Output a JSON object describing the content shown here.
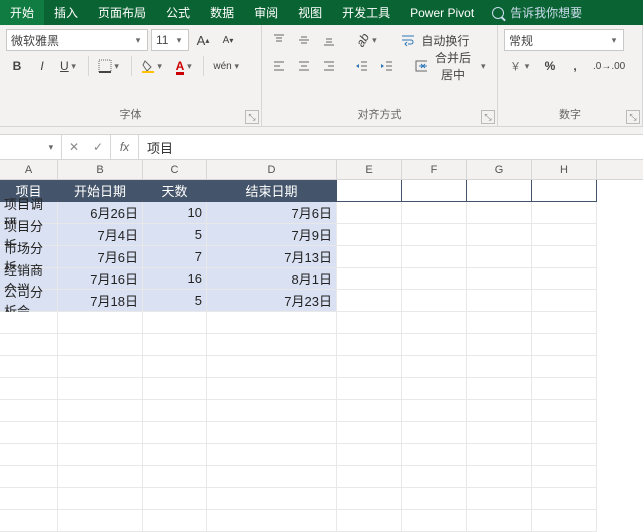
{
  "tabs": {
    "t0": "开始",
    "t1": "插入",
    "t2": "页面布局",
    "t3": "公式",
    "t4": "数据",
    "t5": "审阅",
    "t6": "视图",
    "t7": "开发工具",
    "t8": "Power Pivot",
    "tellme": "告诉我你想要"
  },
  "font": {
    "name": "微软雅黑",
    "size": "11",
    "inc": "A",
    "dec": "A",
    "phonetic": "wén",
    "group": "字体"
  },
  "align": {
    "wrap": "自动换行",
    "merge": "合并后居中",
    "group": "对齐方式"
  },
  "number": {
    "format": "常规",
    "group": "数字"
  },
  "fx": {
    "name": "",
    "value": "项目"
  },
  "cols": [
    "A",
    "B",
    "C",
    "D",
    "E",
    "F",
    "G",
    "H"
  ],
  "table": {
    "head": [
      "项目",
      "开始日期",
      "天数",
      "结束日期"
    ],
    "rows": [
      [
        "项目调研",
        "6月26日",
        "10",
        "7月6日"
      ],
      [
        "项目分析",
        "7月4日",
        "5",
        "7月9日"
      ],
      [
        "市场分析",
        "7月6日",
        "7",
        "7月13日"
      ],
      [
        "经销商会议",
        "7月16日",
        "16",
        "8月1日"
      ],
      [
        "公司分析会",
        "7月18日",
        "5",
        "7月23日"
      ]
    ]
  }
}
